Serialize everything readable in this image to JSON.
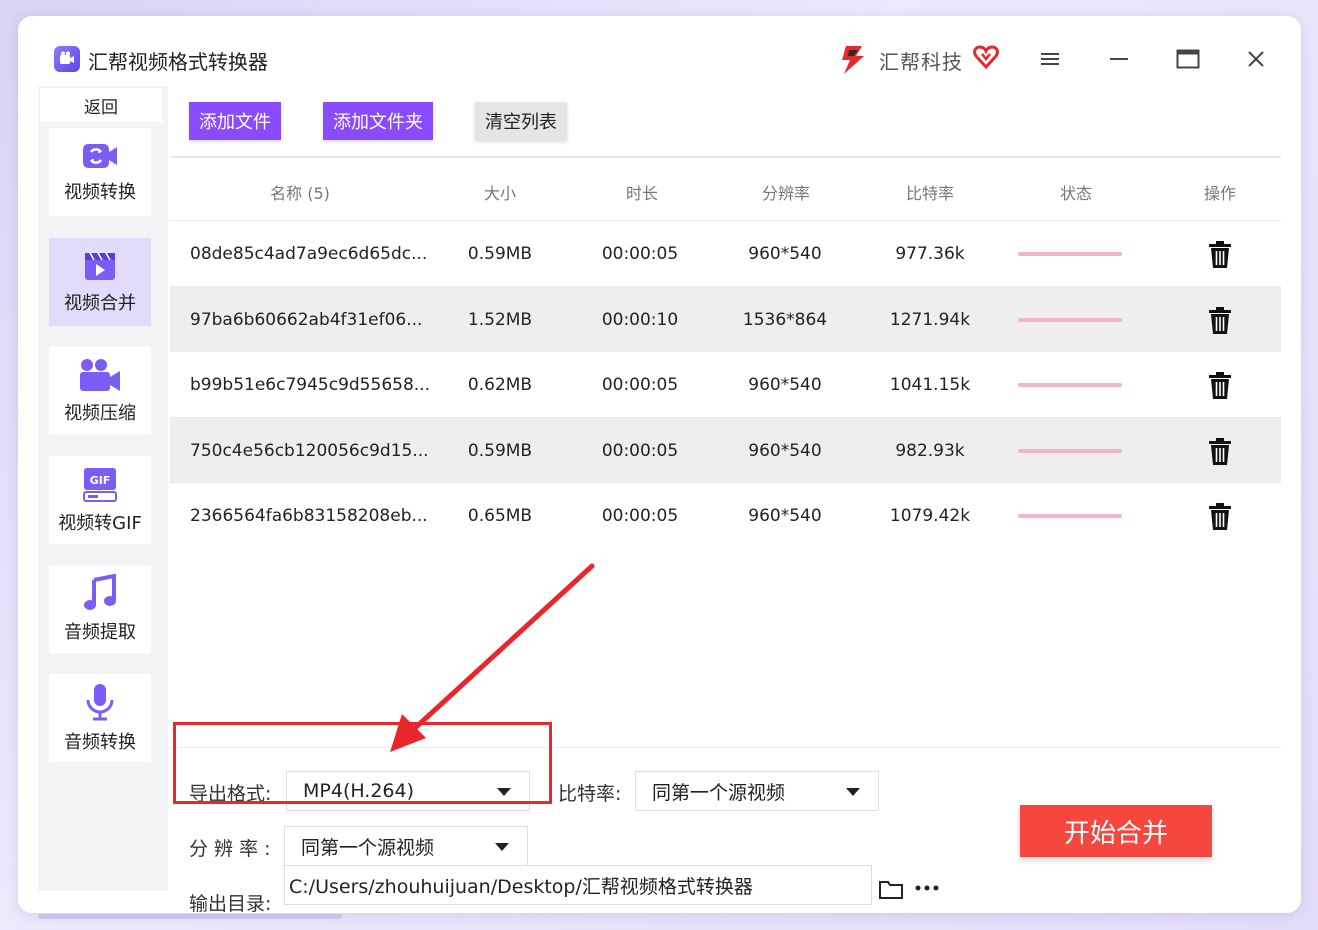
{
  "app": {
    "title": "汇帮视频格式转换器",
    "brand": "汇帮科技"
  },
  "sidebar": {
    "back_label": "返回",
    "items": [
      {
        "label": "视频转换",
        "icon": "video-convert-icon",
        "active": false
      },
      {
        "label": "视频合并",
        "icon": "video-merge-icon",
        "active": true
      },
      {
        "label": "视频压缩",
        "icon": "video-compress-icon",
        "active": false
      },
      {
        "label": "视频转GIF",
        "icon": "gif-icon",
        "active": false
      },
      {
        "label": "音频提取",
        "icon": "music-note-icon",
        "active": false
      },
      {
        "label": "音频转换",
        "icon": "microphone-icon",
        "active": false
      }
    ]
  },
  "toolbar": {
    "add_file": "添加文件",
    "add_folder": "添加文件夹",
    "clear_list": "清空列表"
  },
  "table": {
    "headers": {
      "name": "名称 (5)",
      "size": "大小",
      "duration": "时长",
      "resolution": "分辨率",
      "bitrate": "比特率",
      "status": "状态",
      "action": "操作"
    },
    "rows": [
      {
        "name": "08de85c4ad7a9ec6d65dc...",
        "size": "0.59MB",
        "duration": "00:00:05",
        "resolution": "960*540",
        "bitrate": "977.36k"
      },
      {
        "name": "97ba6b60662ab4f31ef06...",
        "size": "1.52MB",
        "duration": "00:00:10",
        "resolution": "1536*864",
        "bitrate": "1271.94k"
      },
      {
        "name": "b99b51e6c7945c9d55658...",
        "size": "0.62MB",
        "duration": "00:00:05",
        "resolution": "960*540",
        "bitrate": "1041.15k"
      },
      {
        "name": "750c4e56cb120056c9d15...",
        "size": "0.59MB",
        "duration": "00:00:05",
        "resolution": "960*540",
        "bitrate": "982.93k"
      },
      {
        "name": "2366564fa6b83158208eb...",
        "size": "0.65MB",
        "duration": "00:00:05",
        "resolution": "960*540",
        "bitrate": "1079.42k"
      }
    ]
  },
  "settings": {
    "format_label": "导出格式:",
    "format_value": "MP4(H.264)",
    "bitrate_label": "比特率:",
    "bitrate_value": "同第一个源视频",
    "resolution_label": "分 辨 率 :",
    "resolution_value": "同第一个源视频",
    "output_label": "输出目录:",
    "output_value": "C:/Users/zhouhuijuan/Desktop/汇帮视频格式转换器",
    "start_label": "开始合并"
  },
  "colors": {
    "accent": "#8a4bff",
    "start": "#f5473d",
    "highlight": "#e8262b",
    "active_side": "#e2dcfa"
  }
}
